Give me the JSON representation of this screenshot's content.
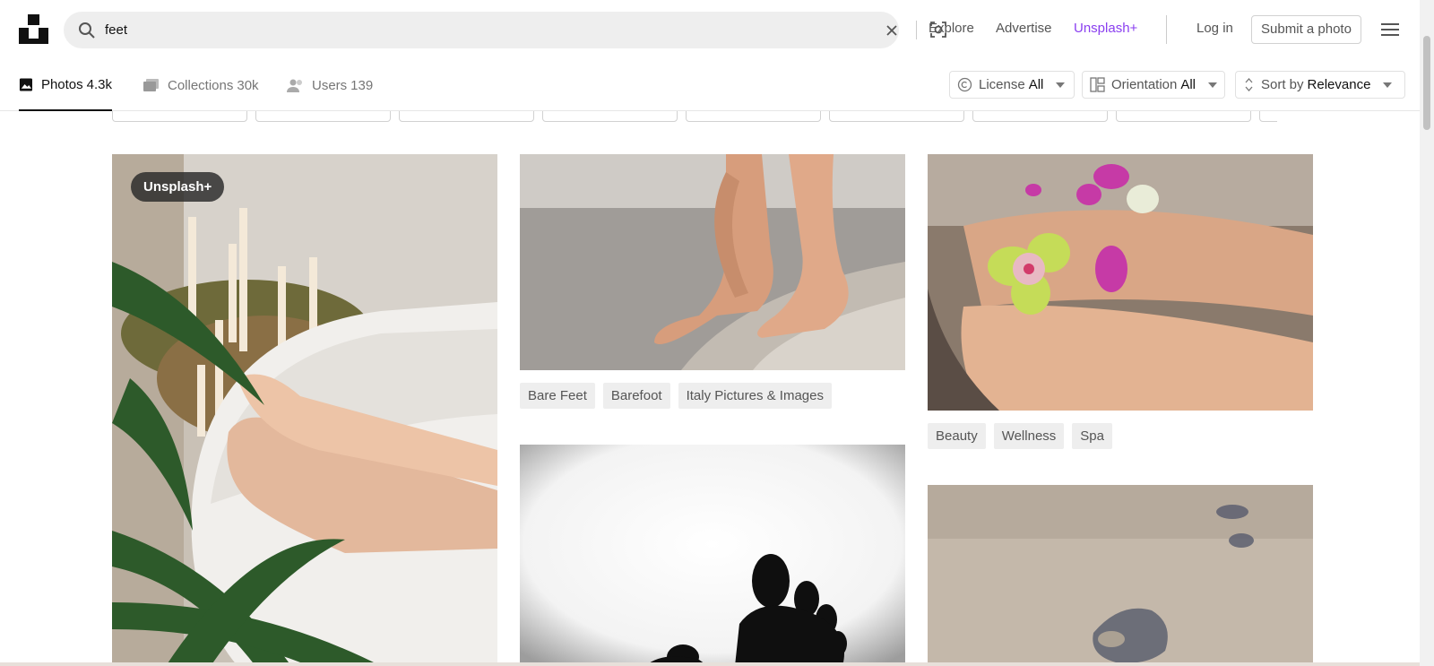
{
  "search": {
    "value": "feet",
    "placeholder": ""
  },
  "nav": {
    "explore": "Explore",
    "advertise": "Advertise",
    "plus": "Unsplash+",
    "login": "Log in",
    "submit": "Submit a photo"
  },
  "tabs": [
    {
      "label": "Photos",
      "count": "4.3k"
    },
    {
      "label": "Collections",
      "count": "30k"
    },
    {
      "label": "Users",
      "count": "139"
    }
  ],
  "filters": {
    "license": {
      "label": "License",
      "value": "All"
    },
    "orientation": {
      "label": "Orientation",
      "value": "All"
    },
    "sort": {
      "label": "Sort by",
      "value": "Relevance"
    }
  },
  "photos": {
    "p1": {
      "badge": "Unsplash+"
    },
    "p2": {
      "tags": [
        "Bare Feet",
        "Barefoot",
        "Italy Pictures & Images"
      ]
    },
    "p3": {
      "tags": [
        "Beauty",
        "Wellness",
        "Spa"
      ]
    }
  },
  "colors": {
    "accent_plus": "#8a3ff0",
    "text_muted": "#767676",
    "tag_bg": "#eeeeee"
  },
  "icons": [
    "unsplash-logo-icon",
    "search-icon",
    "clear-icon",
    "visual-search-icon",
    "menu-icon",
    "photos-icon",
    "collections-icon",
    "users-icon",
    "license-icon",
    "orientation-icon",
    "sort-icon",
    "chevron-down-icon"
  ]
}
